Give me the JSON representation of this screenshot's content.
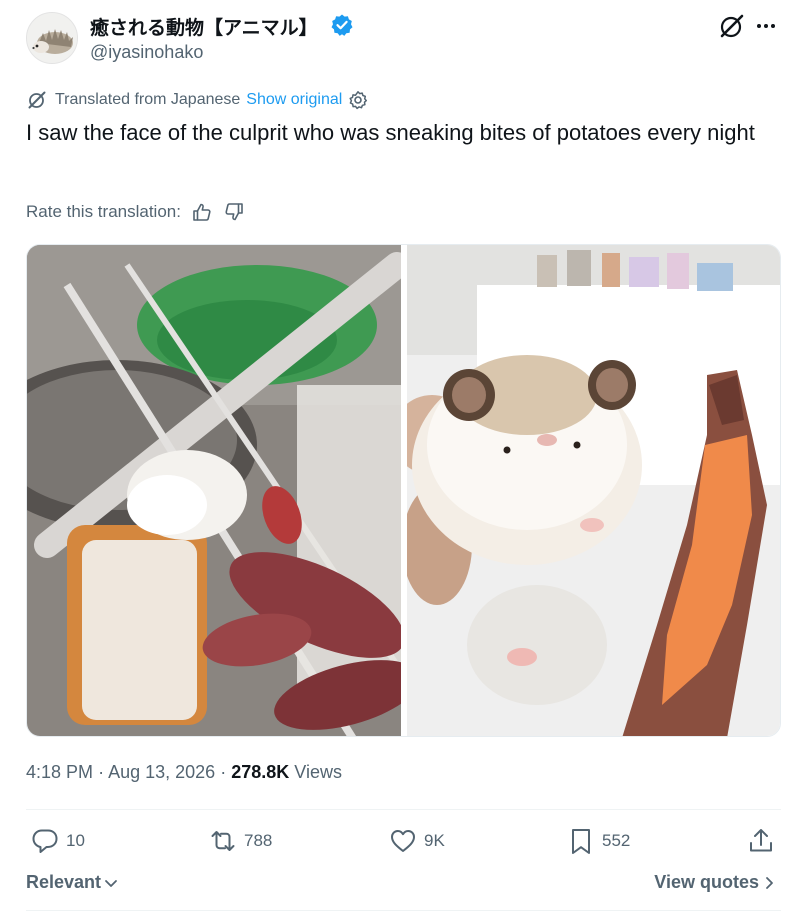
{
  "author": {
    "display_name": "癒される動物【アニマル】",
    "handle": "@iyasinohako",
    "verified_icon": "verified-badge-icon",
    "avatar_icon": "hedgehog-avatar"
  },
  "header_actions": {
    "grok_icon": "grok-icon",
    "more_icon": "more-dots-icon"
  },
  "translation": {
    "label": "Translated from Japanese",
    "show_original": "Show original",
    "settings_icon": "gear-icon"
  },
  "tweet": {
    "text": "I saw the face of the culprit who was sneaking bites of potatoes every night"
  },
  "rate": {
    "label": "Rate this translation:",
    "up_icon": "thumbs-up-icon",
    "down_icon": "thumbs-down-icon"
  },
  "media": {
    "photo_left": "hamster hiding among sweet potatoes in a dish rack",
    "photo_right": "hamster held up next to a nibbled sweet potato"
  },
  "meta": {
    "time": "4:18 PM",
    "separator": "·",
    "date": "Aug 13, 2026",
    "views_count": "278.8K",
    "views_label": "Views"
  },
  "actions": {
    "replies": "10",
    "reposts": "788",
    "likes": "9K",
    "bookmarks": "552"
  },
  "footer": {
    "relevant": "Relevant",
    "view_quotes": "View quotes"
  },
  "colors": {
    "text": "#0f1419",
    "secondary": "#536471",
    "link": "#1d9bf0",
    "verified": "#1d9bf0",
    "divider": "#eff3f4"
  }
}
